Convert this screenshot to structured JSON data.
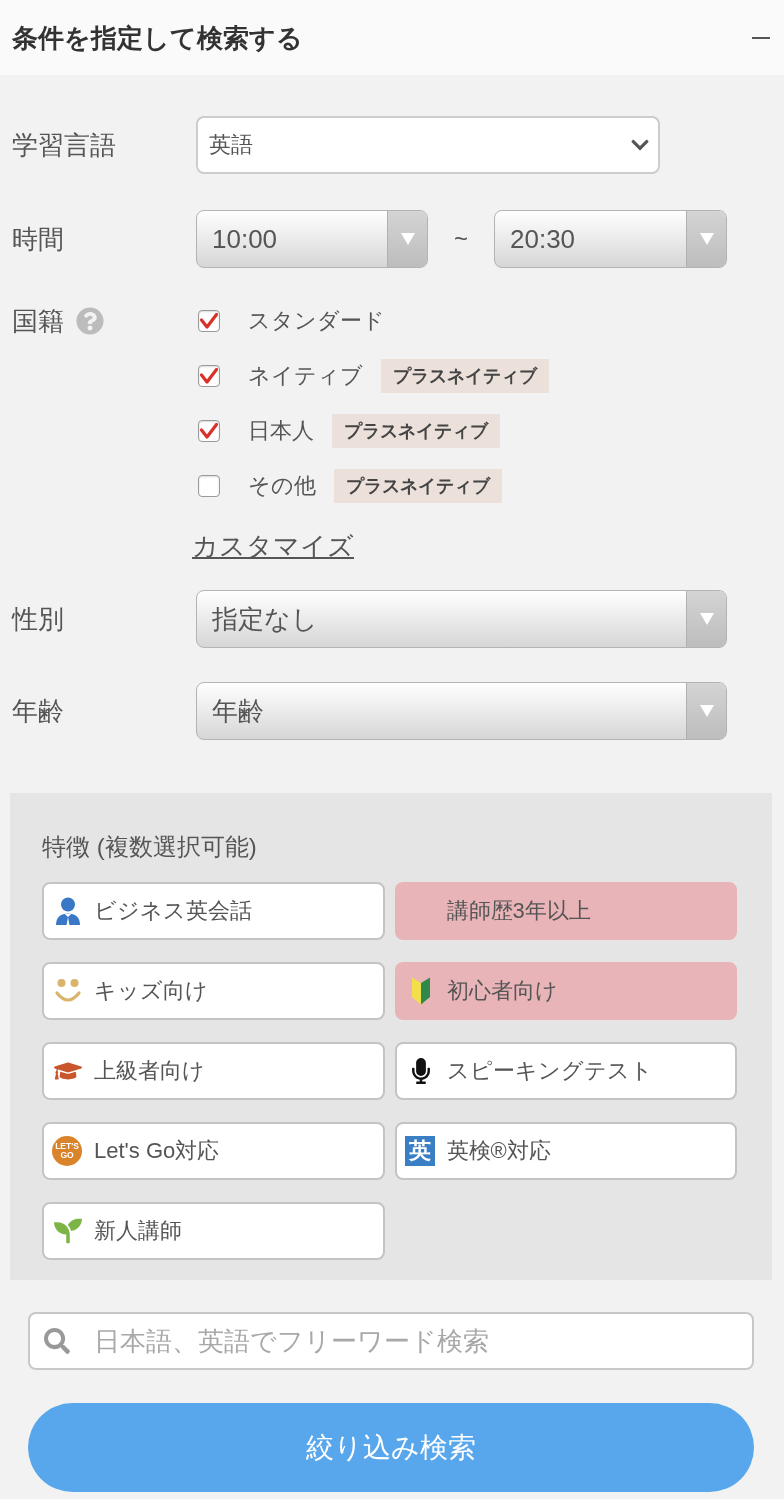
{
  "header": {
    "title": "条件を指定して検索する",
    "expanded": true
  },
  "language": {
    "label": "学習言語",
    "value": "英語"
  },
  "time": {
    "label": "時間",
    "from": "10:00",
    "separator": "~",
    "to": "20:30"
  },
  "nationality": {
    "label": "国籍",
    "options": [
      {
        "label": "スタンダード",
        "checked": true
      },
      {
        "label": "ネイティブ",
        "checked": true,
        "badge": "プラスネイティブ"
      },
      {
        "label": "日本人",
        "checked": true,
        "badge": "プラスネイティブ"
      },
      {
        "label": "その他",
        "checked": false,
        "badge": "プラスネイティブ"
      }
    ],
    "customize_link": "カスタマイズ"
  },
  "gender": {
    "label": "性別",
    "value": "指定なし"
  },
  "age": {
    "label": "年齢",
    "value": "年齢"
  },
  "features": {
    "title": "特徴 (複数選択可能)",
    "items": [
      {
        "label": "ビジネス英会話",
        "kind": "business",
        "selected": false
      },
      {
        "label": "講師歴3年以上",
        "kind": "plain",
        "selected": true
      },
      {
        "label": "キッズ向け",
        "kind": "kids",
        "selected": false
      },
      {
        "label": "初心者向け",
        "kind": "beginner",
        "selected": true
      },
      {
        "label": "上級者向け",
        "kind": "advanced",
        "selected": false
      },
      {
        "label": "スピーキングテスト",
        "kind": "speaking",
        "selected": false
      },
      {
        "label": "Let's Go対応",
        "kind": "letsgo",
        "mark": "LET'S GO",
        "selected": false
      },
      {
        "label": "英検®対応",
        "kind": "eiken",
        "mark": "英",
        "selected": false
      },
      {
        "label": "新人講師",
        "kind": "sprout",
        "selected": false
      }
    ]
  },
  "search": {
    "placeholder": "日本語、英語でフリーワード検索"
  },
  "submit_button": "絞り込み検索"
}
